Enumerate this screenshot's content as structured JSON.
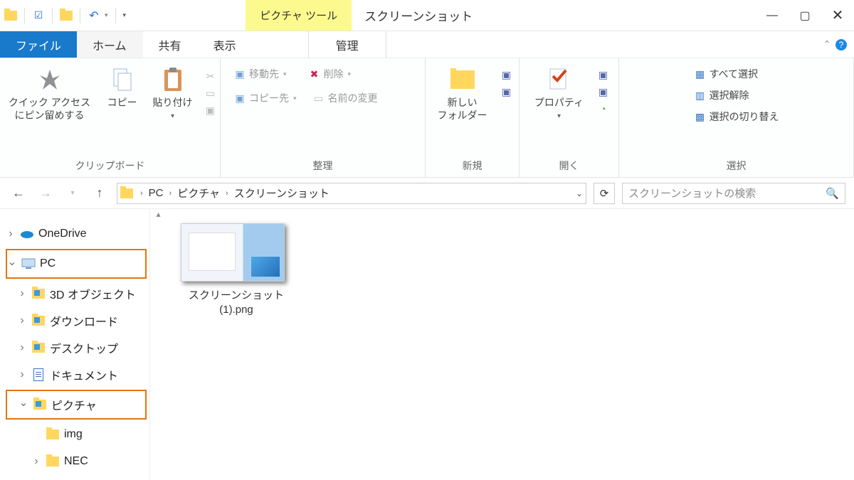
{
  "titlebar": {
    "pic_tools": "ピクチャ ツール",
    "window_title": "スクリーンショット"
  },
  "tabs": {
    "file": "ファイル",
    "home": "ホーム",
    "share": "共有",
    "view": "表示",
    "manage": "管理"
  },
  "ribbon": {
    "clipboard": {
      "pin": "クイック アクセス\nにピン留めする",
      "copy": "コピー",
      "paste": "貼り付け",
      "group": "クリップボード"
    },
    "organize": {
      "move_to": "移動先",
      "copy_to": "コピー先",
      "delete": "削除",
      "rename": "名前の変更",
      "group": "整理"
    },
    "new": {
      "new_folder": "新しい\nフォルダー",
      "group": "新規"
    },
    "open": {
      "properties": "プロパティ",
      "group": "開く"
    },
    "select": {
      "select_all": "すべて選択",
      "select_none": "選択解除",
      "invert": "選択の切り替え",
      "group": "選択"
    }
  },
  "breadcrumb": {
    "pc": "PC",
    "pictures": "ピクチャ",
    "screenshots": "スクリーンショット"
  },
  "search_placeholder": "スクリーンショットの検索",
  "tree": {
    "onedrive": "OneDrive",
    "pc": "PC",
    "objects3d": "3D オブジェクト",
    "downloads": "ダウンロード",
    "desktop": "デスクトップ",
    "documents": "ドキュメント",
    "pictures": "ピクチャ",
    "img": "img",
    "nec": "NEC"
  },
  "file": {
    "name": "スクリーンショット (1).png"
  }
}
